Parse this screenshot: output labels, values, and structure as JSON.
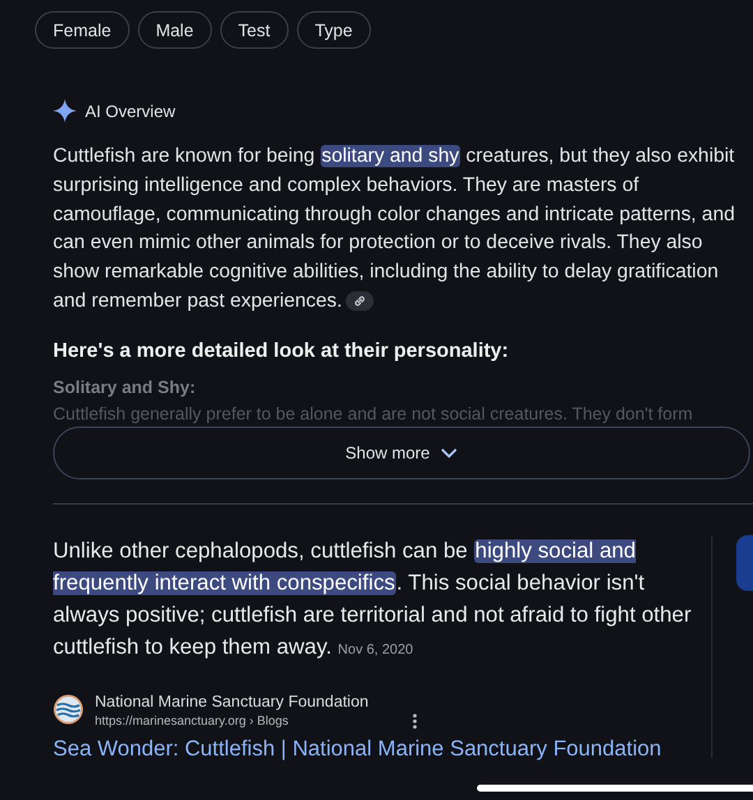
{
  "chips": [
    {
      "label": "Female"
    },
    {
      "label": "Male"
    },
    {
      "label": "Test"
    },
    {
      "label": "Type"
    }
  ],
  "ai_overview": {
    "title": "AI Overview",
    "summary": [
      {
        "text": "Cuttlefish are known for being ",
        "highlighted": false
      },
      {
        "text": "solitary and shy",
        "highlighted": true
      },
      {
        "text": " creatures, but they also exhibit surprising intelligence and complex behaviors. They are masters of camouflage, communicating through color changes and intricate patterns, and can even mimic other animals for protection or to deceive rivals. They also show remarkable cognitive abilities, including the ability to delay gratification and remember past experiences.",
        "highlighted": false
      }
    ],
    "heading": "Here's a more detailed look at their personality:",
    "subheading": "Solitary and Shy:",
    "faded_text": "Cuttlefish generally prefer to be alone and are not social creatures. They don't form",
    "show_more": "Show more"
  },
  "snippet": {
    "text": [
      {
        "text": "Unlike other cephalopods, cuttlefish can be ",
        "highlighted": false
      },
      {
        "text": "highly social and frequently interact with conspecifics",
        "highlighted": true
      },
      {
        "text": ". This social behavior isn't always positive; cuttlefish are territorial and not afraid to fight other cuttlefish to keep them away.",
        "highlighted": false
      }
    ],
    "date": "Nov 6, 2020",
    "source": "National Marine Sanctuary Foundation",
    "url": "https://marinesanctuary.org › Blogs",
    "title": "Sea Wonder: Cuttlefish | National Marine Sanctuary Foundation"
  }
}
